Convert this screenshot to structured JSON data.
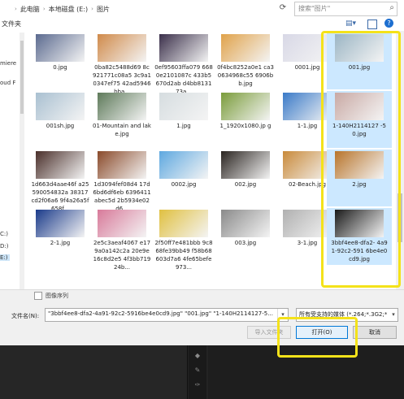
{
  "breadcrumb": {
    "items": [
      "此电脑",
      "本地磁盘 (E:)",
      "图片"
    ],
    "separator": "›"
  },
  "search": {
    "placeholder": "搜索\"图片\""
  },
  "toolbar": {
    "new_folder": "文件夹",
    "view_icon": "view-icon",
    "help": "?"
  },
  "nav": {
    "items": [
      "miere",
      "oud F",
      "C:)",
      "D:)",
      "E:)"
    ]
  },
  "files": [
    {
      "name": "0.jpg",
      "color": "#5b6a8f",
      "selected": false
    },
    {
      "name": "0ba82c5488d69 8c921771c08a5 3c9a10347ef75 42ad5946bba...",
      "color": "#d08a4a",
      "selected": false
    },
    {
      "name": "0ef95603ffa079 6680e2101087c 433b5670d2ab d4bb813173a...",
      "color": "#3a2f4a",
      "selected": false
    },
    {
      "name": "0f4bc8252a0e1 ca30634968c55 6906bb.jpg",
      "color": "#e0a24a",
      "selected": false
    },
    {
      "name": "0001.jpg",
      "color": "#d8d8e6",
      "selected": false
    },
    {
      "name": "001.jpg",
      "color": "#9bb5c4",
      "selected": true
    },
    {
      "name": "001sh.jpg",
      "color": "#a9c0d1",
      "selected": false
    },
    {
      "name": "01-Mountain and lake.jpg",
      "color": "#5e7a5a",
      "selected": false
    },
    {
      "name": "1.jpg",
      "color": "#d6dde0",
      "selected": false
    },
    {
      "name": "1_1920x1080.jp g",
      "color": "#7a9c3a",
      "selected": false
    },
    {
      "name": "1-1.jpg",
      "color": "#3a7ac8",
      "selected": false
    },
    {
      "name": "1-140H2114127 -50.jpg",
      "color": "#c9a9a4",
      "selected": true
    },
    {
      "name": "1d663d4aae46f a25590054832a 38317cd2f06a6 9f4a26a5f658f...",
      "color": "#4a2f2a",
      "selected": false
    },
    {
      "name": "1d3094fef08d4 17d6bd6df6eb 6396411abec5d 2b5934e02d6...",
      "color": "#8a4a2a",
      "selected": false
    },
    {
      "name": "0002.jpg",
      "color": "#5ea8e0",
      "selected": false
    },
    {
      "name": "002.jpg",
      "color": "#2a2420",
      "selected": false
    },
    {
      "name": "02-Beach.jpg",
      "color": "#c98a3a",
      "selected": false
    },
    {
      "name": "2.jpg",
      "color": "#b8742a",
      "selected": true
    },
    {
      "name": "2-1.jpg",
      "color": "#1a3a8a",
      "selected": false
    },
    {
      "name": "2e5c3aeaf4067 e179a0a142c2a 20e9e16c8d2e5 4f3bb71924b...",
      "color": "#d87a9a",
      "selected": false
    },
    {
      "name": "2f50ff7e481bbb 9c868fe39bb49 f58b68603d7a6 4fe65befe973...",
      "color": "#e0c040",
      "selected": false
    },
    {
      "name": "003.jpg",
      "color": "#8a8a8a",
      "selected": false
    },
    {
      "name": "3-1.jpg",
      "color": "#b0b0b0",
      "selected": false
    },
    {
      "name": "3bbf4ee8-dfa2- 4a91-92c2-591 6be4e0cd9.jpg",
      "color": "#1a1a1a",
      "selected": true
    }
  ],
  "bottom": {
    "sequence_label": "图像序列",
    "filename_label": "文件名(N):",
    "filename_value": "\"3bbf4ee8-dfa2-4a91-92c2-5916be4e0cd9.jpg\" \"001.jpg\" \"1-140H2114127-5...",
    "filter_value": "所有受支持的媒体 (*.264;*.3G2;*",
    "import_folder": "导入文件夹",
    "open": "打开(O)",
    "cancel": "取消"
  },
  "colors": {
    "highlight": "#f4e21a",
    "selection": "#cce8ff",
    "accent": "#0078d7"
  }
}
